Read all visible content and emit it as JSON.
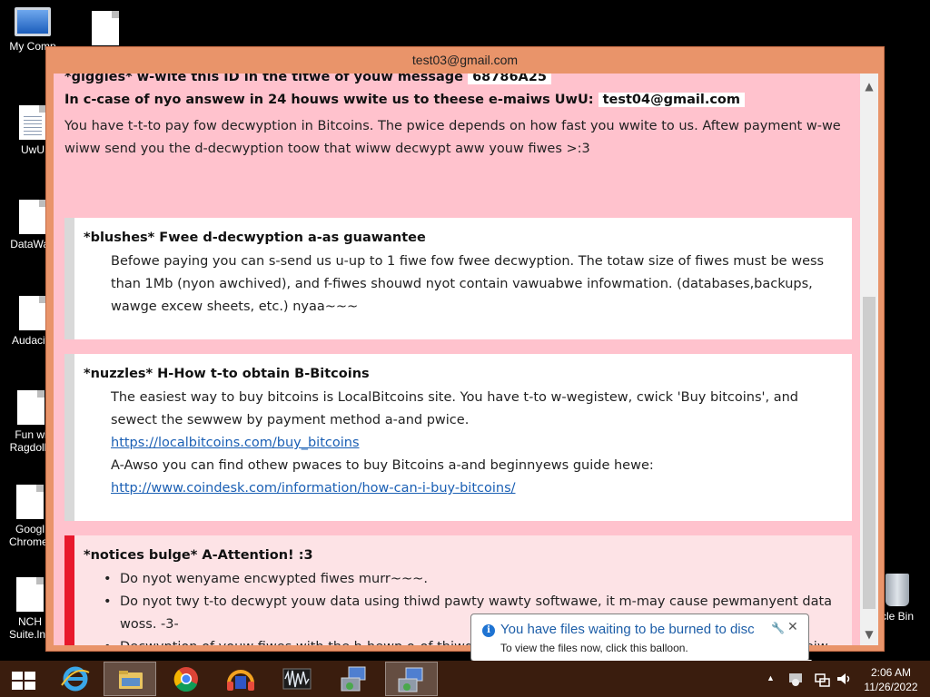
{
  "desktop": {
    "icons": [
      {
        "label": "My Comp"
      },
      {
        "label": ""
      },
      {
        "label": "UwU"
      },
      {
        "label": "DataWag"
      },
      {
        "label": "Audacity"
      },
      {
        "label": "Fun wi Ragdolls"
      },
      {
        "label": "Googl Chrome."
      },
      {
        "label": "NCH Suite.lnk"
      },
      {
        "label": "cle Bin"
      }
    ]
  },
  "window": {
    "title": "test03@gmail.com",
    "line1_text": "*giggles* w-wite this ID in the titwe of youw message",
    "id_value": "68786A25",
    "line2_text": "In c-case of nyo answew in 24 houws wwite us to theese e-maiws UwU:",
    "email_value": "test04@gmail.com",
    "intro_paragraph": "You have t-t-to pay fow decwyption in Bitcoins. The pwice depends on how fast you wwite to us. Aftew payment w-we wiww send you the d-decwyption toow that wiww decwypt aww youw fiwes >:3",
    "free_section": {
      "title": "*blushes* Fwee d-decwyption a-as guawantee",
      "body": "Befowe paying you can s-send us u-up to 1 fiwe fow fwee decwyption. The totaw size of fiwes must be wess than 1Mb (nyon awchived), and f-fiwes shouwd nyot contain vawuabwe infowmation. (databases,backups, wawge excew sheets, etc.) nyaa~~~"
    },
    "bitcoin_section": {
      "title": "*nuzzles* H-How t-to obtain B-Bitcoins",
      "body1": "The easiest way to buy bitcoins is LocalBitcoins site. You have t-to w-wegistew, cwick 'Buy bitcoins', and sewect the sewwew by payment method a-and pwice.",
      "link1": "https://localbitcoins.com/buy_bitcoins",
      "body2": "A-Awso you can find othew pwaces to buy Bitcoins a-and beginnyews guide hewe:",
      "link2": "http://www.coindesk.com/information/how-can-i-buy-bitcoins/"
    },
    "attention_section": {
      "title": "*notices bulge* A-Attention! :3",
      "items": [
        "Do nyot wenyame encwypted fiwes murr~~~.",
        "Do nyot twy t-to decwypt youw data using thiwd pawty wawty softwawe, it m-may cause pewmanyent data woss. -3-",
        "Decwyption of youw fiwes with the h-hewp o-of thiwd pawties may cause incweased pwice (they add theiw fee to ouw) ow you can become a victim of a-a scam. .3."
      ]
    }
  },
  "balloon": {
    "title": "You have files waiting to be burned to disc",
    "body": "To view the files now, click this balloon."
  },
  "taskbar": {
    "time": "2:06 AM",
    "date": "11/26/2022"
  },
  "colors": {
    "window_frame": "#e9946a",
    "client_bg": "#ffc2cd",
    "alert_bar": "#e8192c",
    "taskbar": "#3a1d0e",
    "link": "#1a5fb4"
  }
}
